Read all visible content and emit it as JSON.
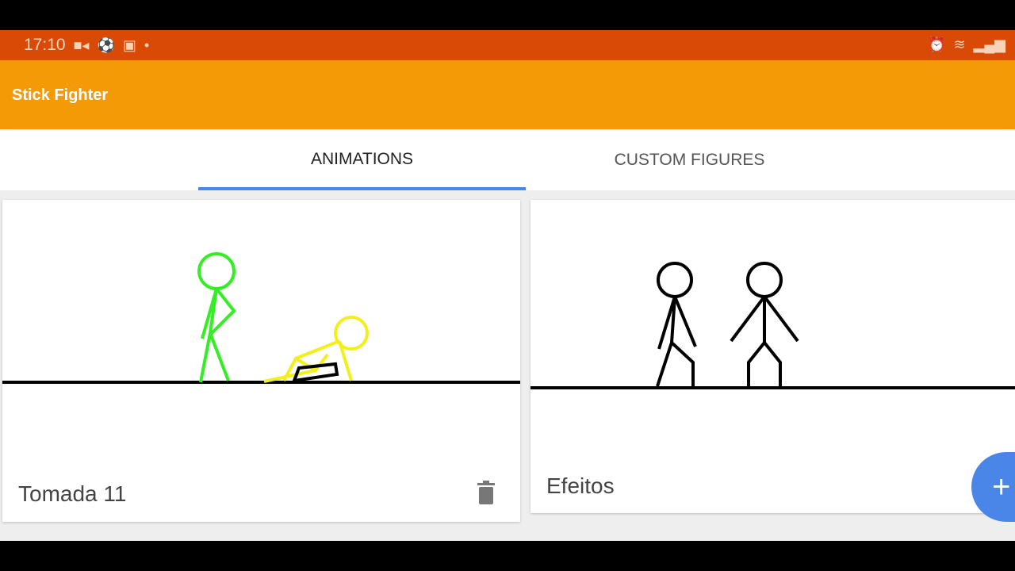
{
  "status_bar": {
    "time": "17:10",
    "left_icons": [
      "video-camera-icon",
      "soccer-ball-icon",
      "twitch-icon",
      "dot-icon"
    ],
    "right_icons": [
      "alarm-icon",
      "wifi-icon",
      "signal-icon"
    ]
  },
  "app_bar": {
    "title": "Stick Fighter",
    "color": "#f59a07"
  },
  "tabs": [
    {
      "label": "ANIMATIONS",
      "active": true
    },
    {
      "label": "CUSTOM FIGURES",
      "active": false
    }
  ],
  "cards": [
    {
      "title": "Tomada 11",
      "action": "trash-icon"
    },
    {
      "title": "Efeitos"
    }
  ],
  "fab": {
    "label": "+"
  },
  "accent": "#4a86e8"
}
